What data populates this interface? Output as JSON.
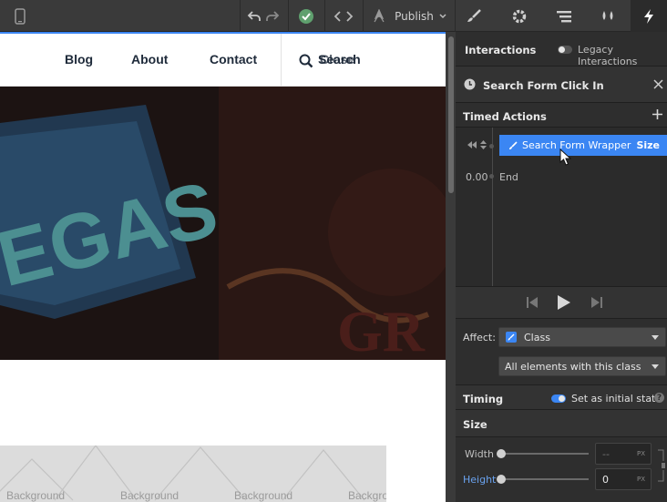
{
  "toolbar": {
    "publish_label": "Publish",
    "icons": [
      "device-icon",
      "undo-icon",
      "redo-icon",
      "check-icon",
      "code-icon",
      "rocket-icon",
      "brush-icon",
      "gear-icon",
      "layers-icon",
      "drops-icon",
      "bolt-icon"
    ]
  },
  "canvas": {
    "nav_links": [
      "Blog",
      "About",
      "Contact"
    ],
    "search_text_a": "Search",
    "search_text_b": "Close",
    "bg_label": "Background"
  },
  "panel": {
    "interactions_title": "Interactions",
    "legacy_label": "Legacy Interactions",
    "trigger_name": "Search Form Click In",
    "timed_actions": "Timed Actions",
    "action_target": "Search Form Wrapper",
    "action_property": "Size",
    "end_time": "0.00",
    "end_label": "End",
    "affect_label": "Affect:",
    "affect_value": "Class",
    "scope_value": "All elements with this class",
    "timing_label": "Timing",
    "initial_state_label": "Set as initial state",
    "size_label": "Size",
    "width_label": "Width",
    "width_value": "--",
    "width_unit": "PX",
    "height_label": "Height",
    "height_value": "0",
    "height_unit": "PX"
  },
  "colors": {
    "accent": "#3b86f3",
    "panel_bg": "#2e2e2e",
    "topbar_bg": "#3a3a3a"
  }
}
